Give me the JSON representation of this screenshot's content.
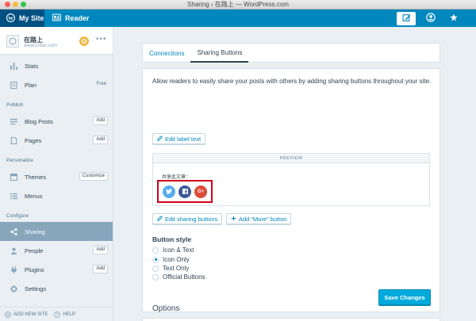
{
  "window": {
    "title": "Sharing ‹ 在路上 — WordPress.com"
  },
  "masterbar": {
    "my_site": "My Site",
    "reader": "Reader",
    "icons": [
      "wordpress-icon",
      "reader-icon",
      "write-icon",
      "me-icon",
      "notifications-icon"
    ]
  },
  "site": {
    "name": "在路上",
    "url": "www.crifan.com"
  },
  "sidebar": {
    "items": [
      {
        "label": "Stats",
        "icon": "stats-icon"
      },
      {
        "label": "Plan",
        "icon": "plan-icon",
        "tag": "Free"
      },
      {
        "label": "Blog Posts",
        "icon": "posts-icon",
        "badge": "Add"
      },
      {
        "label": "Pages",
        "icon": "pages-icon",
        "badge": "Add"
      },
      {
        "label": "Themes",
        "icon": "themes-icon",
        "badge": "Customize"
      },
      {
        "label": "Menus",
        "icon": "menus-icon"
      },
      {
        "label": "Sharing",
        "icon": "share-icon",
        "active": true
      },
      {
        "label": "People",
        "icon": "people-icon",
        "badge": "Add"
      },
      {
        "label": "Plugins",
        "icon": "plugins-icon",
        "badge": "Add"
      },
      {
        "label": "Settings",
        "icon": "settings-icon"
      }
    ],
    "sections": {
      "publish": "Publish",
      "personalize": "Personalize",
      "configure": "Configure"
    },
    "footer": {
      "add_new_site": "ADD NEW SITE",
      "help": "HELP"
    }
  },
  "tabs": [
    {
      "label": "Connections",
      "active": false
    },
    {
      "label": "Sharing Buttons",
      "active": true
    }
  ],
  "sharing": {
    "intro": "Allow readers to easily share your posts with others by adding sharing buttons throughout your site.",
    "edit_label_text": "Edit label text",
    "preview_header": "PREVIEW",
    "share_label": "共享此文章：",
    "buttons": [
      "twitter-icon",
      "facebook-icon",
      "google-plus-icon"
    ],
    "google_plus_glyph": "G+",
    "edit_sharing_buttons": "Edit sharing buttons",
    "add_more_button": "Add “More” button",
    "button_style_title": "Button style",
    "style_options": [
      {
        "label": "Icon & Text",
        "checked": false
      },
      {
        "label": "Icon Only",
        "checked": true
      },
      {
        "label": "Text Only",
        "checked": false
      },
      {
        "label": "Official Buttons",
        "checked": false
      }
    ],
    "save_changes": "Save Changes"
  },
  "options": {
    "title": "Options"
  },
  "colors": {
    "masterbar": "#0087be",
    "primary_button": "#00aadc",
    "highlight_box": "#d0021b",
    "twitter": "#55acee",
    "facebook": "#3b5998",
    "google_plus": "#dd4b39"
  }
}
